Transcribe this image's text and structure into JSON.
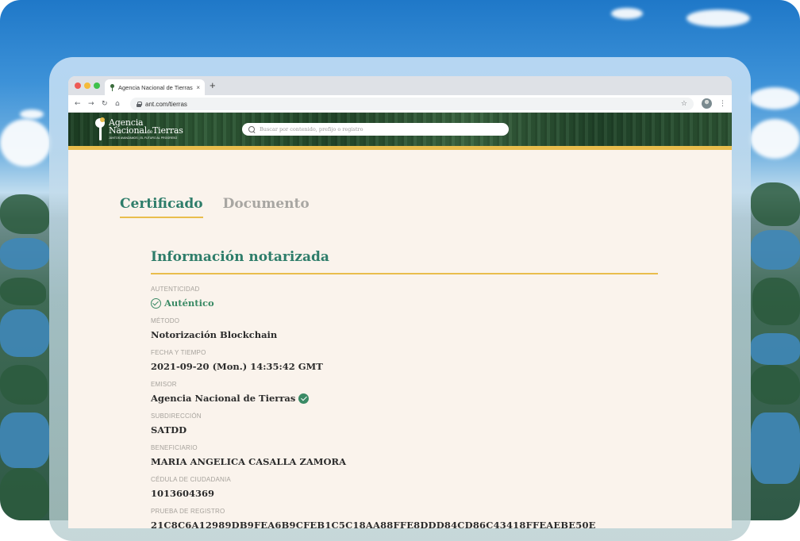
{
  "browser": {
    "tab_title": "Agencia Nacional de Tierras",
    "tab_close": "×",
    "new_tab": "+",
    "url": "ant.com/tierras",
    "nav_back": "←",
    "nav_forward": "→",
    "nav_reload": "↻",
    "nav_home": "⌂",
    "star": "☆",
    "menu": "⋮"
  },
  "site": {
    "logo_line1": "Agencia",
    "logo_line2_a": "Nacional",
    "logo_line2_b": "de",
    "logo_line2_c": "Tierras",
    "logo_tagline": "JUNTOS AVANZAMOS | EL FUTURO AL PROGRESO",
    "search_placeholder": "Buscar por contenido, prefijo o registro"
  },
  "tabs": {
    "certificado": "Certificado",
    "documento": "Documento"
  },
  "section": {
    "title": "Información notarizada"
  },
  "fields": {
    "autenticidad_label": "AUTENTICIDAD",
    "autenticidad_value": "Auténtico",
    "metodo_label": "MÉTODO",
    "metodo_value": "Notorización Blockchain",
    "fecha_label": "FECHA Y TIEMPO",
    "fecha_value": "2021-09-20 (Mon.) 14:35:42 GMT",
    "emisor_label": "EMISOR",
    "emisor_value": "Agencia Nacional de Tierras",
    "subdireccion_label": "SUBDIRECCIÓN",
    "subdireccion_value": "SATDD",
    "beneficiario_label": "BENEFICIARIO",
    "beneficiario_value": "MARIA ANGELICA CASALLA ZAMORA",
    "cedula_label": "CÉDULA DE CIUDADANIA",
    "cedula_value": "1013604369",
    "prueba_label": "PRUEBA DE REGISTRO",
    "prueba_value": "21C8C6A12989DB9FEA6B9CFEB1C5C18AA88FFE8DDD84CD86C43418FFEAEBE50E"
  },
  "colors": {
    "accent_green": "#2e7d6a",
    "gold": "#e9bd4c",
    "page_bg": "#faf3ec"
  }
}
